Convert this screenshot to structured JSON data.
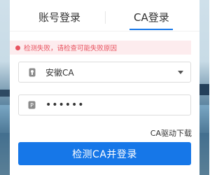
{
  "tabs": [
    {
      "label": "账号登录",
      "active": false
    },
    {
      "label": "CA登录",
      "active": true
    }
  ],
  "error": {
    "message": "检测失败，请检查可能失败原因"
  },
  "ca_select": {
    "value": "安徽CA"
  },
  "password": {
    "value": "••••••"
  },
  "links": {
    "download": "CA驱动下载"
  },
  "submit": {
    "label": "检测CA并登录"
  },
  "colors": {
    "accent": "#1677e8",
    "error": "#e8525f",
    "error_bg": "#fdecee"
  }
}
